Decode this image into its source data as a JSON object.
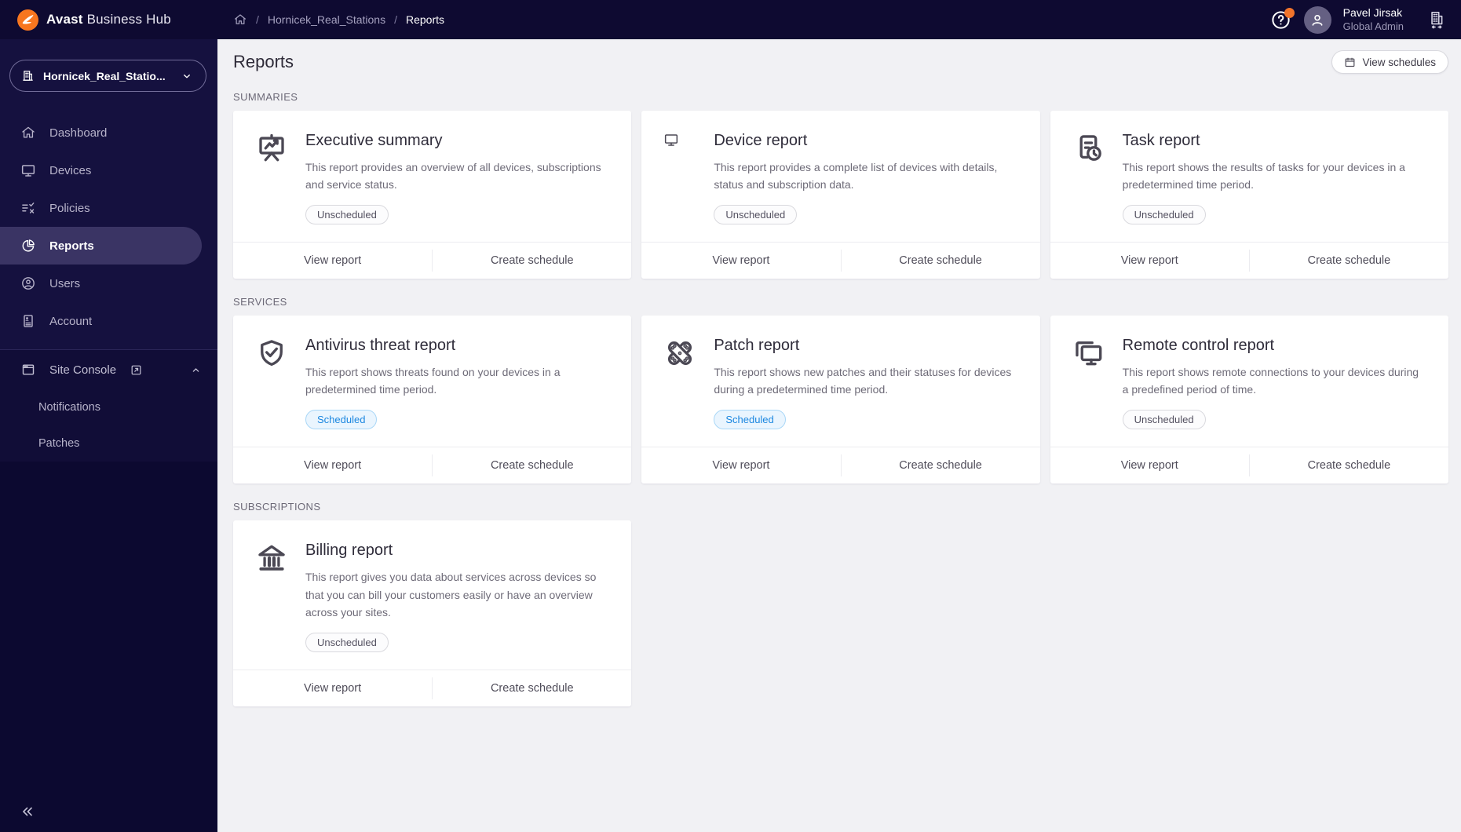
{
  "brand": {
    "name_bold": "Avast",
    "name_rest": "Business Hub"
  },
  "site_selector": {
    "label": "Hornicek_Real_Statio..."
  },
  "sidebar": {
    "items": [
      {
        "label": "Dashboard",
        "icon": "home-icon",
        "active": false
      },
      {
        "label": "Devices",
        "icon": "monitor-icon",
        "active": false
      },
      {
        "label": "Policies",
        "icon": "policies-icon",
        "active": false
      },
      {
        "label": "Reports",
        "icon": "pie-chart-icon",
        "active": true
      },
      {
        "label": "Users",
        "icon": "users-icon",
        "active": false
      },
      {
        "label": "Account",
        "icon": "account-card-icon",
        "active": false
      }
    ],
    "site_console_label": "Site Console",
    "sub_items": [
      {
        "label": "Notifications"
      },
      {
        "label": "Patches"
      }
    ]
  },
  "breadcrumb": {
    "site": "Hornicek_Real_Stations",
    "current": "Reports"
  },
  "user": {
    "name": "Pavel Jirsak",
    "role": "Global Admin"
  },
  "page": {
    "title": "Reports",
    "view_schedules_label": "View schedules"
  },
  "badges": {
    "scheduled": "Scheduled",
    "unscheduled": "Unscheduled"
  },
  "card_actions": {
    "view_report": "View report",
    "create_schedule": "Create schedule"
  },
  "sections": [
    {
      "label": "SUMMARIES",
      "cards": [
        {
          "title": "Executive summary",
          "icon": "presentation-chart-icon",
          "status": "unscheduled",
          "description": "This report provides an overview of all devices, subscriptions and service status."
        },
        {
          "title": "Device report",
          "icon": "monitor-icon",
          "status": "unscheduled",
          "description": "This report provides a complete list of devices with details, status and subscription data."
        },
        {
          "title": "Task report",
          "icon": "document-clock-icon",
          "status": "unscheduled",
          "description": "This report shows the results of tasks for your devices in a predetermined time period."
        }
      ]
    },
    {
      "label": "SERVICES",
      "cards": [
        {
          "title": "Antivirus threat report",
          "icon": "shield-check-icon",
          "status": "scheduled",
          "description": "This report shows threats found on your devices in a predetermined time period."
        },
        {
          "title": "Patch report",
          "icon": "patches-icon",
          "status": "scheduled",
          "description": "This report shows new patches and their statuses for devices during a predetermined time period."
        },
        {
          "title": "Remote control report",
          "icon": "remote-monitors-icon",
          "status": "unscheduled",
          "description": "This report shows remote connections to your devices during a predefined period of time."
        }
      ]
    },
    {
      "label": "SUBSCRIPTIONS",
      "cards": [
        {
          "title": "Billing report",
          "icon": "bank-icon",
          "status": "unscheduled",
          "description": "This report gives you data about services across devices so that you can bill your customers easily or have an overview across your sites."
        }
      ]
    }
  ],
  "colors": {
    "brand_orange": "#F7761F",
    "sidebar_bg": "#15113F",
    "header_bg": "#0E0A31",
    "active_item_bg": "#3A3464",
    "content_bg": "#F1F1F4",
    "scheduled_blue": "#1B87E0",
    "badge_gray_text": "#535060"
  }
}
